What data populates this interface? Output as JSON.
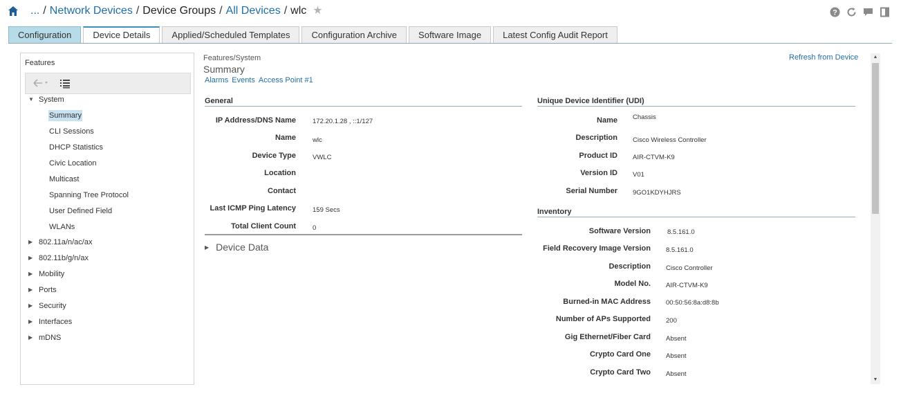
{
  "breadcrumb": {
    "ellipsis": "...",
    "items": [
      "Network Devices",
      "Device Groups",
      "All Devices",
      "wlc"
    ],
    "separator": "/"
  },
  "header_icons": [
    "help-icon",
    "refresh-icon",
    "chat-icon",
    "panel-icon"
  ],
  "tabs": [
    {
      "label": "Configuration"
    },
    {
      "label": "Device Details"
    },
    {
      "label": "Applied/Scheduled Templates"
    },
    {
      "label": "Configuration Archive"
    },
    {
      "label": "Software Image"
    },
    {
      "label": "Latest Config Audit Report"
    }
  ],
  "features": {
    "title": "Features",
    "system": {
      "label": "System",
      "children": [
        "Summary",
        "CLI Sessions",
        "DHCP Statistics",
        "Civic Location",
        "Multicast",
        "Spanning Tree Protocol",
        "User Defined Field",
        "WLANs"
      ]
    },
    "groups": [
      "802.11a/n/ac/ax",
      "802.11b/g/n/ax",
      "Mobility",
      "Ports",
      "Security",
      "Interfaces",
      "mDNS"
    ]
  },
  "content": {
    "breadcrumb": "Features/System",
    "title": "Summary",
    "links": [
      "Alarms",
      "Events",
      "Access Point #1"
    ],
    "refresh": "Refresh from Device",
    "general": {
      "title": "General",
      "rows": [
        {
          "label": "IP Address/DNS Name",
          "value": "172.20.1.28 , ::1/127"
        },
        {
          "label": "Name",
          "value": "wlc"
        },
        {
          "label": "Device Type",
          "value": "VWLC"
        },
        {
          "label": "Location",
          "value": ""
        },
        {
          "label": "Contact",
          "value": ""
        },
        {
          "label": "Last ICMP Ping Latency",
          "value": "159 Secs"
        },
        {
          "label": "Total Client Count",
          "value": "0"
        }
      ]
    },
    "device_data": "Device Data",
    "udi": {
      "title": "Unique Device Identifier (UDI)",
      "rows": [
        {
          "label": "Name",
          "value": "Chassis"
        },
        {
          "label": "Description",
          "value": "Cisco Wireless Controller"
        },
        {
          "label": "Product ID",
          "value": "AIR-CTVM-K9"
        },
        {
          "label": "Version ID",
          "value": "V01"
        },
        {
          "label": "Serial Number",
          "value": "9GO1KDYHJRS"
        }
      ]
    },
    "inventory": {
      "title": "Inventory",
      "rows": [
        {
          "label": "Software Version",
          "value": "8.5.161.0"
        },
        {
          "label": "Field Recovery Image Version",
          "value": "8.5.161.0"
        },
        {
          "label": "Description",
          "value": "Cisco Controller"
        },
        {
          "label": "Model No.",
          "value": "AIR-CTVM-K9"
        },
        {
          "label": "Burned-in MAC Address",
          "value": "00:50:56:8a:d8:8b"
        },
        {
          "label": "Number of APs Supported",
          "value": "200"
        },
        {
          "label": "Gig Ethernet/Fiber Card",
          "value": "Absent"
        },
        {
          "label": "Crypto Card One",
          "value": "Absent"
        },
        {
          "label": "Crypto Card Two",
          "value": "Absent"
        }
      ]
    }
  },
  "colors": {
    "link": "#1f6fa8",
    "active_tab_accent": "#3b8fbf",
    "selected_tab_bg": "#b8dbea",
    "tree_selected_bg": "#c7e2f1"
  }
}
